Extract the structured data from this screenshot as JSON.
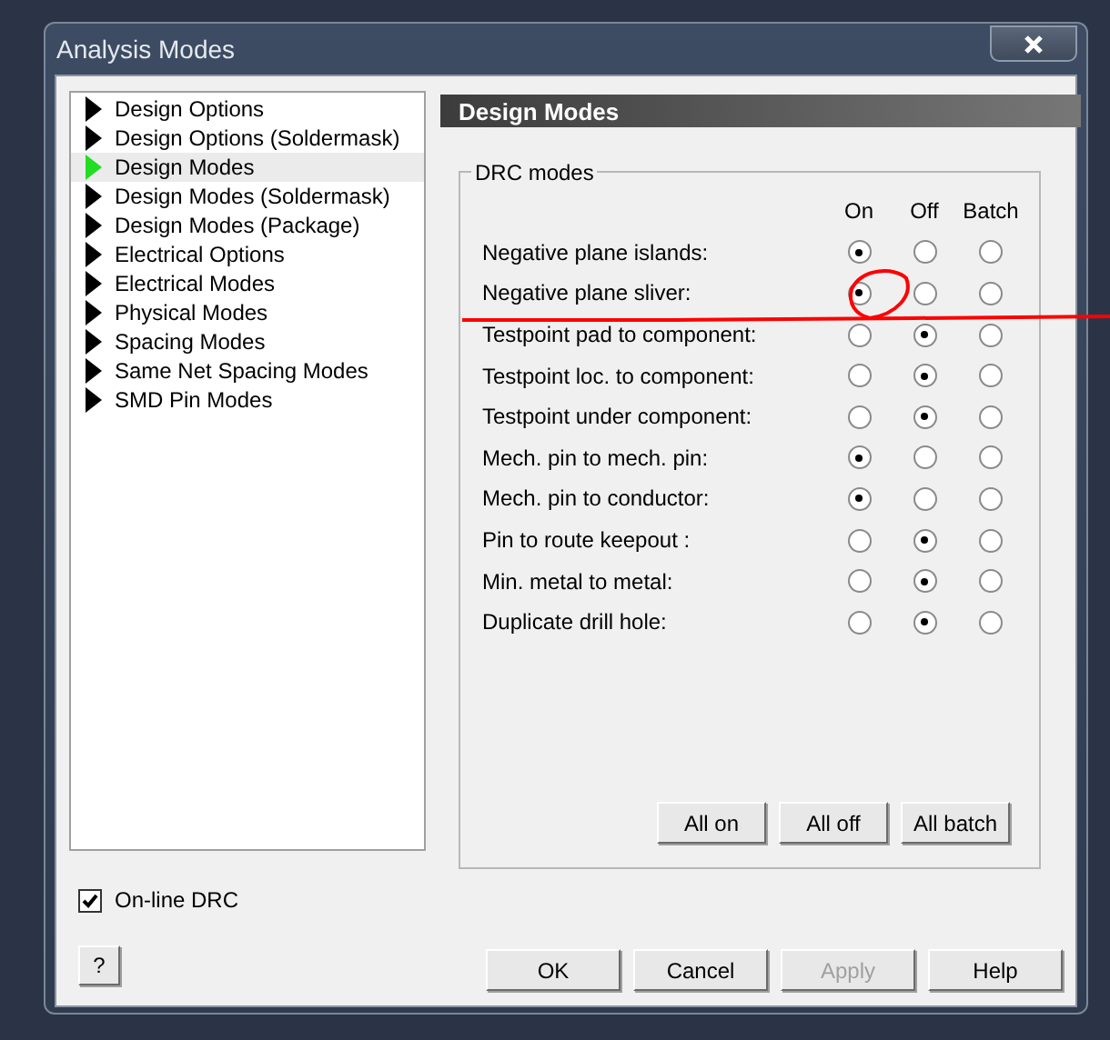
{
  "window": {
    "title": "Analysis Modes"
  },
  "sidebar": {
    "items": [
      {
        "label": "Design Options",
        "selected": false
      },
      {
        "label": "Design Options (Soldermask)",
        "selected": false
      },
      {
        "label": "Design Modes",
        "selected": true
      },
      {
        "label": "Design Modes (Soldermask)",
        "selected": false
      },
      {
        "label": "Design Modes (Package)",
        "selected": false
      },
      {
        "label": "Electrical Options",
        "selected": false
      },
      {
        "label": "Electrical Modes",
        "selected": false
      },
      {
        "label": "Physical Modes",
        "selected": false
      },
      {
        "label": "Spacing Modes",
        "selected": false
      },
      {
        "label": "Same Net Spacing Modes",
        "selected": false
      },
      {
        "label": "SMD Pin Modes",
        "selected": false
      }
    ]
  },
  "panel": {
    "title": "Design Modes",
    "group": {
      "legend": "DRC modes",
      "columns": [
        "On",
        "Off",
        "Batch"
      ],
      "rows": [
        {
          "label": "Negative plane islands:",
          "options": [
            {
              "selected": true
            },
            {
              "selected": false
            },
            {
              "selected": false
            }
          ]
        },
        {
          "label": "Negative plane sliver:",
          "options": [
            {
              "selected": true
            },
            {
              "selected": false
            },
            {
              "selected": false
            }
          ]
        },
        {
          "label": "Testpoint pad to component:",
          "options": [
            {
              "selected": false
            },
            {
              "selected": true
            },
            {
              "selected": false
            }
          ]
        },
        {
          "label": "Testpoint loc. to component:",
          "options": [
            {
              "selected": false
            },
            {
              "selected": true
            },
            {
              "selected": false
            }
          ]
        },
        {
          "label": "Testpoint under component:",
          "options": [
            {
              "selected": false
            },
            {
              "selected": true
            },
            {
              "selected": false
            }
          ]
        },
        {
          "label": "Mech. pin to mech. pin:",
          "options": [
            {
              "selected": true
            },
            {
              "selected": false
            },
            {
              "selected": false
            }
          ]
        },
        {
          "label": "Mech. pin to conductor:",
          "options": [
            {
              "selected": true
            },
            {
              "selected": false
            },
            {
              "selected": false
            }
          ]
        },
        {
          "label": "Pin to route keepout :",
          "options": [
            {
              "selected": false
            },
            {
              "selected": true
            },
            {
              "selected": false
            }
          ]
        },
        {
          "label": "Min. metal to metal:",
          "options": [
            {
              "selected": false
            },
            {
              "selected": true
            },
            {
              "selected": false
            }
          ]
        },
        {
          "label": "Duplicate drill hole:",
          "options": [
            {
              "selected": false
            },
            {
              "selected": true
            },
            {
              "selected": false
            }
          ]
        }
      ],
      "buttons": [
        "All on",
        "All off",
        "All batch"
      ]
    }
  },
  "online_drc": {
    "label": "On-line DRC",
    "checked": true
  },
  "help_button": "?",
  "buttons": [
    {
      "label": "OK",
      "disabled": false
    },
    {
      "label": "Cancel",
      "disabled": false
    },
    {
      "label": "Apply",
      "disabled": true
    },
    {
      "label": "Help",
      "disabled": false
    }
  ]
}
